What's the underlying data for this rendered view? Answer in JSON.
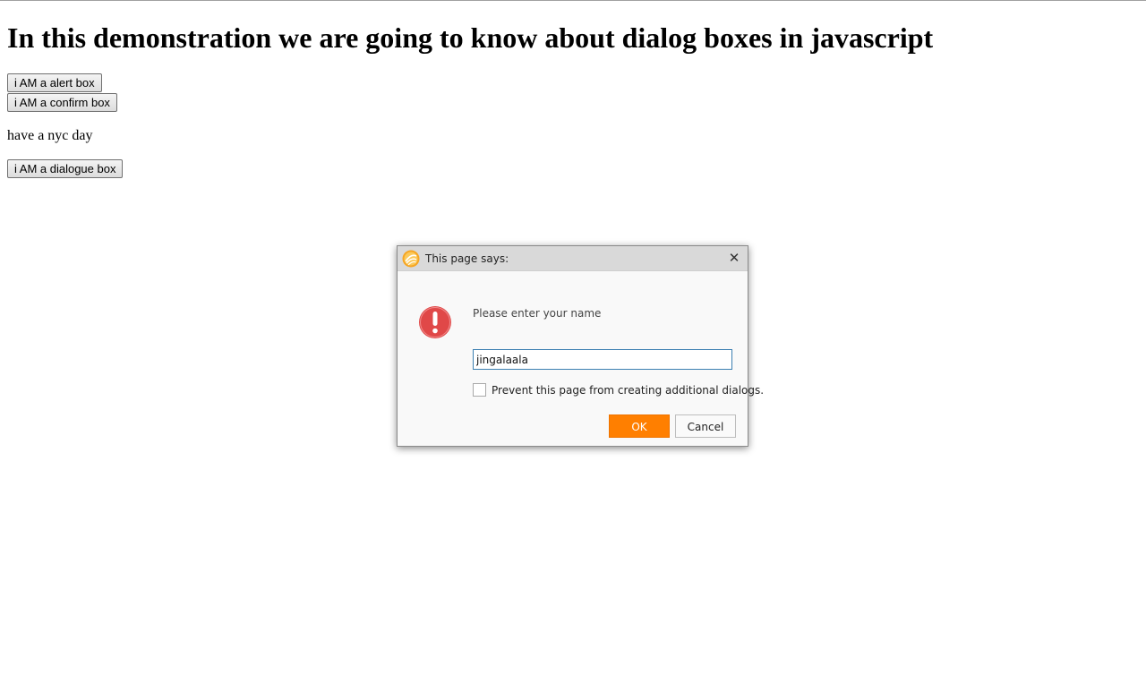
{
  "page": {
    "title": "In this demonstration we are going to know about dialog boxes in javascript",
    "buttons": {
      "alert_label": "i AM a alert box",
      "confirm_label": "i AM a confirm box",
      "dialogue_label": "i AM a dialogue box"
    },
    "greeting": "have a nyc day"
  },
  "dialog": {
    "title": "This page says:",
    "close_glyph": "✕",
    "message": "Please enter your name",
    "input_value": "jingalaala",
    "checkbox_label": "Prevent this page from creating additional dialogs.",
    "checkbox_checked": false,
    "ok_label": "OK",
    "cancel_label": "Cancel",
    "icons": {
      "logo": "browser-logo-icon",
      "warning": "exclamation-icon"
    },
    "colors": {
      "ok_button": "#ff7f00",
      "warning_icon": "#e04848",
      "input_border": "#3c7fb1"
    }
  }
}
